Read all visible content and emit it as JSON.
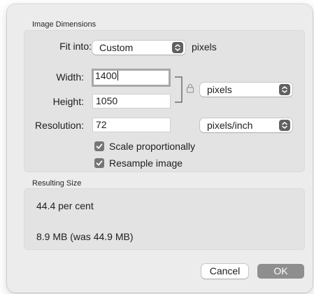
{
  "image_dimensions": {
    "section_title": "Image Dimensions",
    "fit_into": {
      "label": "Fit into:",
      "value": "Custom",
      "unit": "pixels"
    },
    "width": {
      "label": "Width:",
      "value": "1400"
    },
    "height": {
      "label": "Height:",
      "value": "1050"
    },
    "size_unit": "pixels",
    "resolution": {
      "label": "Resolution:",
      "value": "72",
      "unit": "pixels/inch"
    },
    "scale_proportionally": {
      "label": "Scale proportionally",
      "checked": true
    },
    "resample_image": {
      "label": "Resample image",
      "checked": true
    }
  },
  "resulting_size": {
    "section_title": "Resulting Size",
    "percent": "44.4 per cent",
    "file_size": "8.9 MB (was 44.9 MB)"
  },
  "buttons": {
    "cancel": "Cancel",
    "ok": "OK"
  },
  "icons": {
    "lock": "lock-icon",
    "stepper": "chevron-up-down-icon",
    "checkmark": "checkmark-icon"
  }
}
